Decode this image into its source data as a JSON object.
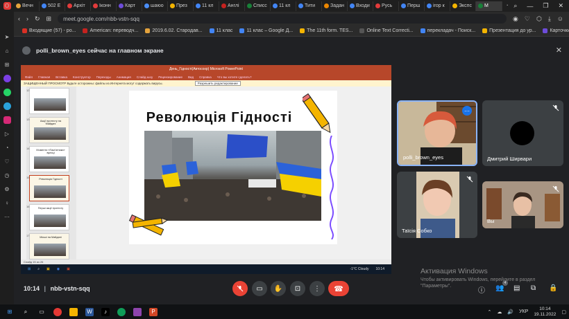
{
  "browser": {
    "tabs": [
      {
        "label": "Вечн",
        "color": "#e4a33d"
      },
      {
        "label": "502 E",
        "color": "#4285f4"
      },
      {
        "label": "Архіт",
        "color": "#e23b3b"
      },
      {
        "label": "Іконн",
        "color": "#e23b3b"
      },
      {
        "label": "Карт",
        "color": "#6d4cd9"
      },
      {
        "label": "шаюо",
        "color": "#4a8df5"
      },
      {
        "label": "През",
        "color": "#f4b400"
      },
      {
        "label": "11 кл",
        "color": "#4285f4"
      },
      {
        "label": "Англі",
        "color": "#c5221f"
      },
      {
        "label": "Списс",
        "color": "#188038"
      },
      {
        "label": "11 кл",
        "color": "#4285f4"
      },
      {
        "label": "Тити",
        "color": "#4285f4"
      },
      {
        "label": "Задан",
        "color": "#ea8600"
      },
      {
        "label": "Входи",
        "color": "#4285f4"
      },
      {
        "label": "Русь",
        "color": "#e23b3b"
      },
      {
        "label": "Перш",
        "color": "#4285f4"
      },
      {
        "label": "irop к",
        "color": "#4285f4"
      },
      {
        "label": "Экспс",
        "color": "#f4b400"
      },
      {
        "label": "М",
        "color": "#188038",
        "active": true
      }
    ],
    "url": "meet.google.com/nbb-vstn-sqq",
    "bookmarks": [
      {
        "label": "Входящие (57) - ро...",
        "color": "#d93025"
      },
      {
        "label": "American: переводч...",
        "color": "#c5221f"
      },
      {
        "label": "2019.6.02. Стародав...",
        "color": "#e4a33d"
      },
      {
        "label": "11 клас",
        "color": "#4285f4"
      },
      {
        "label": "11 клас – Google Д...",
        "color": "#4285f4"
      },
      {
        "label": "The 11th form. TES...",
        "color": "#f4b400"
      },
      {
        "label": "Online Text Correcti...",
        "color": "#555"
      },
      {
        "label": "перекладач - Поиск...",
        "color": "#4285f4"
      },
      {
        "label": "Презентация до ур...",
        "color": "#f4b400"
      },
      {
        "label": "Карточки Персона...",
        "color": "#6d4cd9"
      }
    ]
  },
  "meet": {
    "presenter_text": "polli_brown_eyes сейчас на главном экране",
    "meeting_time": "10:14",
    "meeting_code": "nbb-vstn-sqq",
    "participants": [
      {
        "name": "polli_brown_eyes",
        "muted": false
      },
      {
        "name": "Дмитрий Ширвари",
        "muted": true
      },
      {
        "name": "Таїсія Собко",
        "muted": true
      },
      {
        "name": "Вы",
        "muted": true
      }
    ]
  },
  "presentation": {
    "window_title": "День_Гідності(Автосохр) Microsoft PowerPoint",
    "ribbon": [
      "Файл",
      "Главная",
      "Вставка",
      "Конструктор",
      "Переходы",
      "Анимация",
      "Слайд-шоу",
      "Рецензирование",
      "Вид",
      "Справка",
      "Что вы хотите сделать?"
    ],
    "warning": "ЗАЩИЩЕННЫЙ ПРОСМОТР   Будьте осторожны: файлы из Интернета могут содержать вирусы.",
    "warning_button": "Разрешить редактирование",
    "slide_title": "Революція Гідності",
    "thumbnails": [
      {
        "num": "12",
        "label": ""
      },
      {
        "num": "13",
        "label": "Акції протесту на Майдані"
      },
      {
        "num": "14",
        "label": "Моменти «Пам'ятники» вулиці"
      },
      {
        "num": "15",
        "label": "Революція Гідності"
      },
      {
        "num": "16",
        "label": "Перші акції протесту"
      },
      {
        "num": "17",
        "label": "Міські на Майдані"
      }
    ],
    "status": "Слайд 15 из 26",
    "taskbar_weather": "-1°C Cloudy",
    "taskbar_time": "10:14"
  },
  "windows": {
    "activation_title": "Активация Windows",
    "activation_text": "Чтобы активировать Windows, перейдите в раздел \"Параметры\".",
    "language": "УКР",
    "time": "10:14",
    "date": "19.11.2022"
  }
}
